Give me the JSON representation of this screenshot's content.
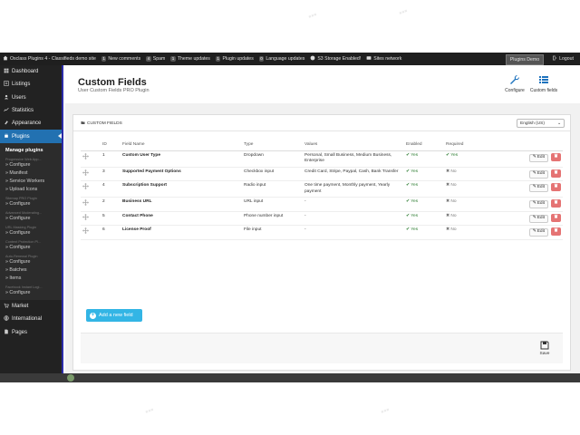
{
  "admin_bar": {
    "site_name": "Osclass Plugins 4 - Classifieds demo site",
    "new_comments_count": "1",
    "new_comments_label": "New comments",
    "spam_count": "4",
    "spam_label": "Spam",
    "theme_updates_count": "1",
    "theme_updates_label": "Theme updates",
    "plugin_updates_count": "1",
    "plugin_updates_label": "Plugin updates",
    "language_updates_count": "0",
    "language_updates_label": "Language updates",
    "storage_label": "S3 Storage Enabled!",
    "sites_network_label": "Sites network",
    "plugins_demo_label": "Plugins Demo",
    "logout_label": "Logout"
  },
  "sidebar": {
    "items": [
      {
        "label": "Dashboard",
        "icon": "dashboard-icon"
      },
      {
        "label": "Listings",
        "icon": "listings-icon"
      },
      {
        "label": "Users",
        "icon": "users-icon"
      },
      {
        "label": "Statistics",
        "icon": "statistics-icon"
      },
      {
        "label": "Appearance",
        "icon": "appearance-icon"
      },
      {
        "label": "Plugins",
        "icon": "plugins-icon"
      }
    ],
    "submenu": {
      "heading": "Manage plugins",
      "groups": [
        {
          "title": "Progressive Web App...",
          "links": [
            "» Configure",
            "» Manifest",
            "» Service Workers",
            "» Upload Icons"
          ]
        },
        {
          "title": "Sitemap PRO Plugin",
          "links": [
            "» Configure"
          ]
        },
        {
          "title": "Advanced Moderating...",
          "links": [
            "» Configure"
          ]
        },
        {
          "title": "URL Masking Plugin",
          "links": [
            "» Configure"
          ]
        },
        {
          "title": "Content Protection Pl...",
          "links": [
            "» Configure"
          ]
        },
        {
          "title": "Auto-Renewal Plugin",
          "links": [
            "» Configure",
            "» Batches",
            "» Items"
          ]
        },
        {
          "title": "Facebook Instant Logi...",
          "links": [
            "» Configure"
          ]
        }
      ]
    },
    "bottom_items": [
      {
        "label": "Market",
        "icon": "market-icon"
      },
      {
        "label": "International",
        "icon": "globe-icon"
      },
      {
        "label": "Pages",
        "icon": "pages-icon"
      }
    ]
  },
  "header": {
    "title": "Custom Fields",
    "subtitle": "User Custom Fields PRO Plugin",
    "configure_label": "Configure",
    "custom_fields_label": "Custom fields"
  },
  "panel": {
    "title": "CUSTOM FIELDS",
    "language_selected": "English (US)"
  },
  "table": {
    "columns": [
      "ID",
      "Field Name",
      "Type",
      "Values",
      "Enabled",
      "Required"
    ],
    "rows": [
      {
        "id": "1",
        "name": "Custom User Type",
        "type": "Dropdown",
        "values": "Personal, Small Business, Medium Business, Enterprise",
        "enabled": "Yes",
        "required": "Yes"
      },
      {
        "id": "3",
        "name": "Supported Payment Options",
        "type": "Checkbox input",
        "values": "Credit Card, Stripe, Paypal, Cash, Bank Transfer",
        "enabled": "Yes",
        "required": "No"
      },
      {
        "id": "4",
        "name": "Subscription Support",
        "type": "Radio input",
        "values": "One time payment, Monthly payment, Yearly payment",
        "enabled": "Yes",
        "required": "No"
      },
      {
        "id": "2",
        "name": "Business URL",
        "type": "URL input",
        "values": "-",
        "enabled": "Yes",
        "required": "No"
      },
      {
        "id": "5",
        "name": "Contact Phone",
        "type": "Phone number input",
        "values": "-",
        "enabled": "Yes",
        "required": "No"
      },
      {
        "id": "6",
        "name": "License Proof",
        "type": "File input",
        "values": "-",
        "enabled": "Yes",
        "required": "No"
      }
    ],
    "edit_label": "Edit"
  },
  "actions": {
    "add_field_label": "Add a new field",
    "save_label": "Save"
  }
}
